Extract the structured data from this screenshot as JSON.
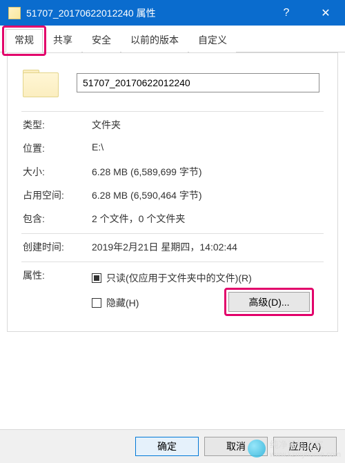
{
  "titlebar": {
    "icon_name": "folder-icon",
    "title": "51707_20170622012240 属性",
    "help_glyph": "?",
    "close_glyph": "✕"
  },
  "tabs": [
    {
      "label": "常规",
      "active": true
    },
    {
      "label": "共享",
      "active": false
    },
    {
      "label": "安全",
      "active": false
    },
    {
      "label": "以前的版本",
      "active": false
    },
    {
      "label": "自定义",
      "active": false
    }
  ],
  "general": {
    "folder_name": "51707_20170622012240",
    "rows": {
      "type": {
        "label": "类型:",
        "value": "文件夹"
      },
      "location": {
        "label": "位置:",
        "value": "E:\\"
      },
      "size": {
        "label": "大小:",
        "value": "6.28 MB (6,589,699 字节)"
      },
      "size_on_disk": {
        "label": "占用空间:",
        "value": "6.28 MB (6,590,464 字节)"
      },
      "contains": {
        "label": "包含:",
        "value": "2 个文件，0 个文件夹"
      },
      "created": {
        "label": "创建时间:",
        "value": "2019年2月21日 星期四，14:02:44"
      }
    },
    "attributes": {
      "label": "属性:",
      "readonly": {
        "label": "只读(仅应用于文件夹中的文件)(R)",
        "state": "indeterminate"
      },
      "hidden": {
        "label": "隐藏(H)",
        "state": "unchecked"
      },
      "advanced_button": "高级(D)..."
    }
  },
  "buttons": {
    "ok": "确定",
    "cancel": "取消",
    "apply": "应用(A)"
  },
  "watermark": {
    "text": "纯净系统之家",
    "url": "www.kzmyhome.com"
  },
  "highlights": [
    {
      "target": "tab-general"
    },
    {
      "target": "advanced-button"
    }
  ]
}
